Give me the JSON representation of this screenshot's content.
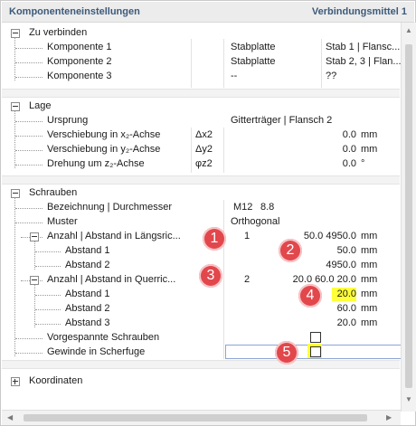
{
  "header": {
    "title": "Komponenteneinstellungen",
    "context": "Verbindungsmittel 1"
  },
  "zu_verbinden": {
    "title": "Zu verbinden",
    "rows": [
      {
        "label": "Komponente 1",
        "type": "Stabplatte",
        "value": "Stab 1 | Flansc..."
      },
      {
        "label": "Komponente 2",
        "type": "Stabplatte",
        "value": "Stab 2, 3 | Flan..."
      },
      {
        "label": "Komponente 3",
        "type": "--",
        "value": "??"
      }
    ]
  },
  "lage": {
    "title": "Lage",
    "ursprung": {
      "label": "Ursprung",
      "value": "Gitterträger | Flansch 2"
    },
    "rows": [
      {
        "label": "Verschiebung in x₂-Achse",
        "symbol": "Δx2",
        "value": "0.0",
        "unit": "mm"
      },
      {
        "label": "Verschiebung in y₂-Achse",
        "symbol": "Δy2",
        "value": "0.0",
        "unit": "mm"
      },
      {
        "label": "Drehung um z₂-Achse",
        "symbol": "φz2",
        "value": "0.0",
        "unit": "°"
      }
    ]
  },
  "schrauben": {
    "title": "Schrauben",
    "bezeichnung": {
      "label": "Bezeichnung | Durchmesser",
      "size": "M12",
      "grade": "8.8"
    },
    "muster": {
      "label": "Muster",
      "value": "Orthogonal"
    },
    "laengs": {
      "label": "Anzahl | Abstand in Längsric...",
      "count": "1",
      "value": "50.0 4950.0",
      "unit": "mm"
    },
    "laengs_abstaende": [
      {
        "label": "Abstand 1",
        "value": "50.0",
        "unit": "mm"
      },
      {
        "label": "Abstand 2",
        "value": "4950.0",
        "unit": "mm"
      }
    ],
    "quer": {
      "label": "Anzahl | Abstand in Querric...",
      "count": "2",
      "value": "20.0 60.0 20.0",
      "unit": "mm"
    },
    "quer_abstaende": [
      {
        "label": "Abstand 1",
        "value": "20.0",
        "unit": "mm"
      },
      {
        "label": "Abstand 2",
        "value": "60.0",
        "unit": "mm"
      },
      {
        "label": "Abstand 3",
        "value": "20.0",
        "unit": "mm"
      }
    ],
    "vorgespannt": {
      "label": "Vorgespannte Schrauben",
      "checked": false
    },
    "gewinde": {
      "label": "Gewinde in Scherfuge",
      "checked": false
    }
  },
  "koordinaten": {
    "title": "Koordinaten"
  },
  "badges": [
    "1",
    "2",
    "3",
    "4",
    "5"
  ],
  "colors": {
    "header_text": "#3c5a7a",
    "badge": "#e2474c",
    "highlight": "#ffff3a"
  }
}
